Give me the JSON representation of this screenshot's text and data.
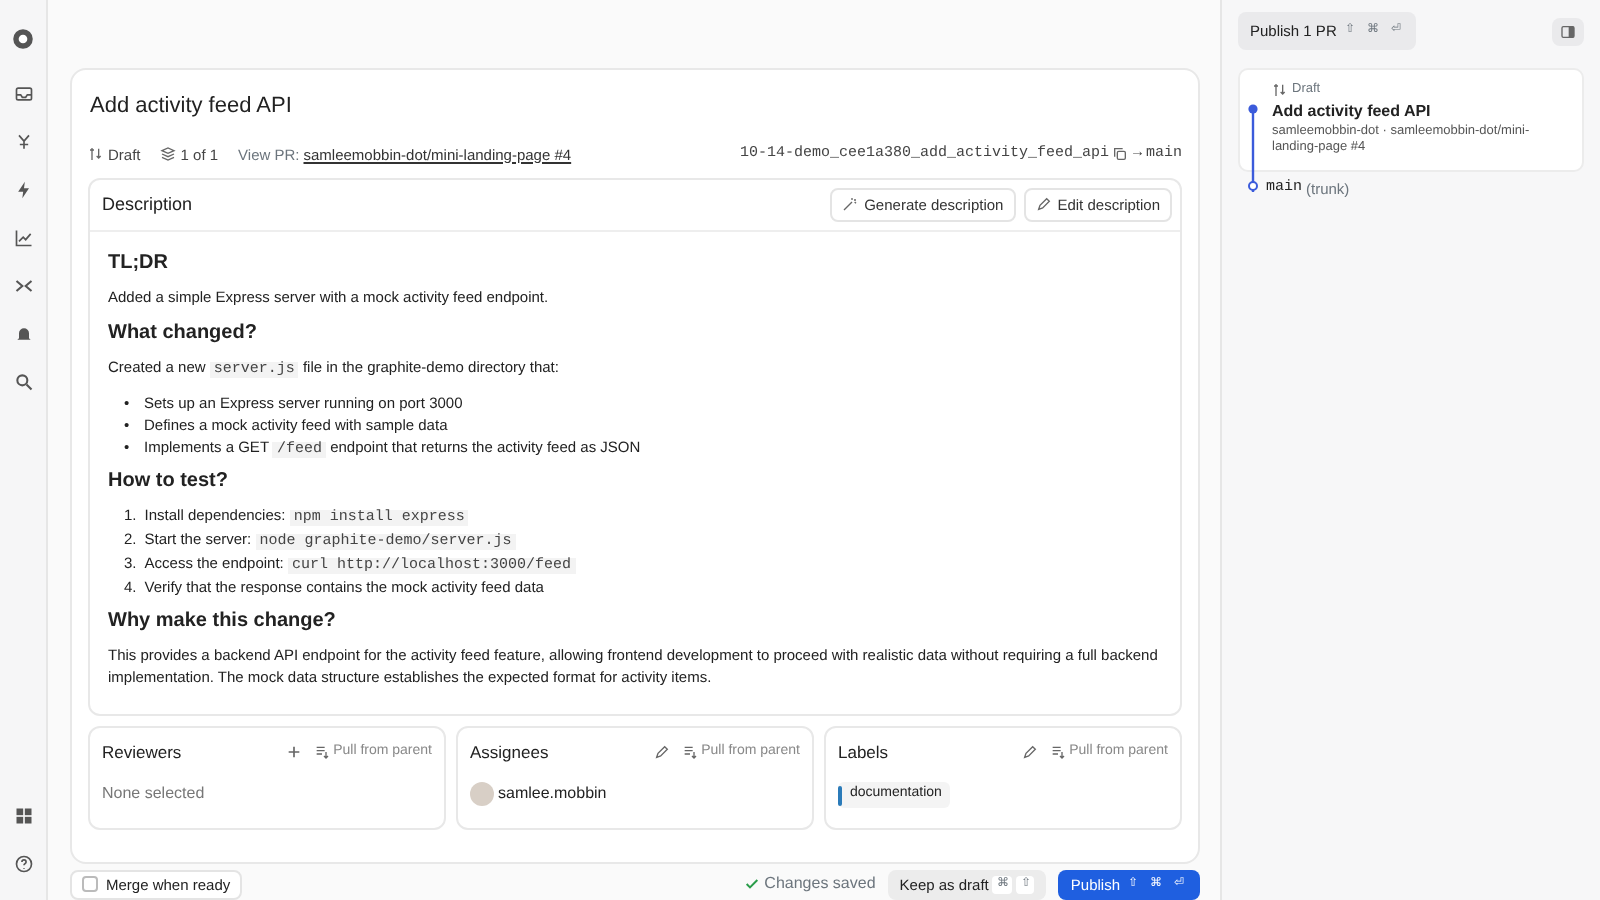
{
  "pr": {
    "title": "Add activity feed API",
    "status": "Draft",
    "stack": "1 of 1",
    "view_pr_label": "View PR:",
    "view_pr_link": "samleemobbin-dot/mini-landing-page #4",
    "branch": "10-14-demo_cee1a380_add_activity_feed_api",
    "arrow": "→",
    "base": "main"
  },
  "description": {
    "title": "Description",
    "buttons": [
      "Generate description",
      "Edit description"
    ],
    "blocks": [
      {
        "kind": "heading",
        "text": "TL;DR"
      },
      {
        "kind": "paragraph",
        "segments": [
          {
            "kind": "text",
            "text": "Added a simple Express server with a mock activity feed endpoint."
          }
        ]
      },
      {
        "kind": "heading",
        "text": "What changed?"
      },
      {
        "kind": "paragraph",
        "segments": [
          {
            "kind": "text",
            "text": "Created a new "
          },
          {
            "kind": "code",
            "text": "server.js"
          },
          {
            "kind": "text",
            "text": " file in the graphite-demo directory that:"
          }
        ]
      },
      {
        "kind": "bullets",
        "items": [
          {
            "marker": "•",
            "segments": [
              {
                "kind": "text",
                "text": "Sets up an Express server running on port 3000"
              }
            ]
          },
          {
            "marker": "•",
            "segments": [
              {
                "kind": "text",
                "text": "Defines a mock activity feed with sample data"
              }
            ]
          },
          {
            "marker": "•",
            "segments": [
              {
                "kind": "text",
                "text": "Implements a GET "
              },
              {
                "kind": "code",
                "text": "/feed"
              },
              {
                "kind": "text",
                "text": " endpoint that returns the activity feed as JSON"
              }
            ]
          }
        ]
      },
      {
        "kind": "heading",
        "text": "How to test?"
      },
      {
        "kind": "numbered",
        "items": [
          {
            "marker": "1.",
            "segments": [
              {
                "kind": "text",
                "text": "Install dependencies: "
              },
              {
                "kind": "code",
                "text": "npm install express"
              }
            ]
          },
          {
            "marker": "2.",
            "segments": [
              {
                "kind": "text",
                "text": "Start the server: "
              },
              {
                "kind": "code",
                "text": "node graphite-demo/server.js"
              }
            ]
          },
          {
            "marker": "3.",
            "segments": [
              {
                "kind": "text",
                "text": "Access the endpoint: "
              },
              {
                "kind": "code",
                "text": "curl http://localhost:3000/feed"
              }
            ]
          },
          {
            "marker": "4.",
            "segments": [
              {
                "kind": "text",
                "text": "Verify that the response contains the mock activity feed data"
              }
            ]
          }
        ]
      },
      {
        "kind": "heading",
        "text": "Why make this change?"
      },
      {
        "kind": "paragraph",
        "segments": [
          {
            "kind": "text",
            "text": "This provides a backend API endpoint for the activity feed feature, allowing frontend development to proceed with realistic data without requiring a full backend implementation. The mock data structure establishes the expected format for activity items."
          }
        ]
      }
    ]
  },
  "fields": [
    {
      "kind": "reviewers",
      "title": "Reviewers",
      "pull": "Pull from parent",
      "empty": "None selected"
    },
    {
      "kind": "assignees",
      "title": "Assignees",
      "pull": "Pull from parent",
      "people": [
        "samlee.mobbin"
      ]
    },
    {
      "kind": "labels",
      "title": "Labels",
      "pull": "Pull from parent",
      "labels": [
        {
          "text": "documentation",
          "color": "#2b7bb9"
        }
      ]
    }
  ],
  "footer": {
    "merge_when_ready": {
      "label": "Merge when ready",
      "checked": false
    },
    "saved": "Changes saved",
    "keep_draft": {
      "label": "Keep as draft",
      "keys": [
        "⌘",
        "⇧"
      ]
    },
    "publish": {
      "label": "Publish",
      "keys": [
        "⇧",
        "⌘",
        "⏎"
      ]
    }
  },
  "right_panel": {
    "publish": {
      "label": "Publish 1 PR",
      "keys": [
        "⇧",
        "⌘",
        "⏎"
      ]
    },
    "stack": [
      {
        "status": "Draft",
        "title": "Add activity feed API",
        "subtitle": "samleemobbin-dot · samleemobbin-dot/mini-landing-page #4"
      }
    ],
    "trunk": {
      "branch": "main",
      "note": "(trunk)"
    }
  }
}
